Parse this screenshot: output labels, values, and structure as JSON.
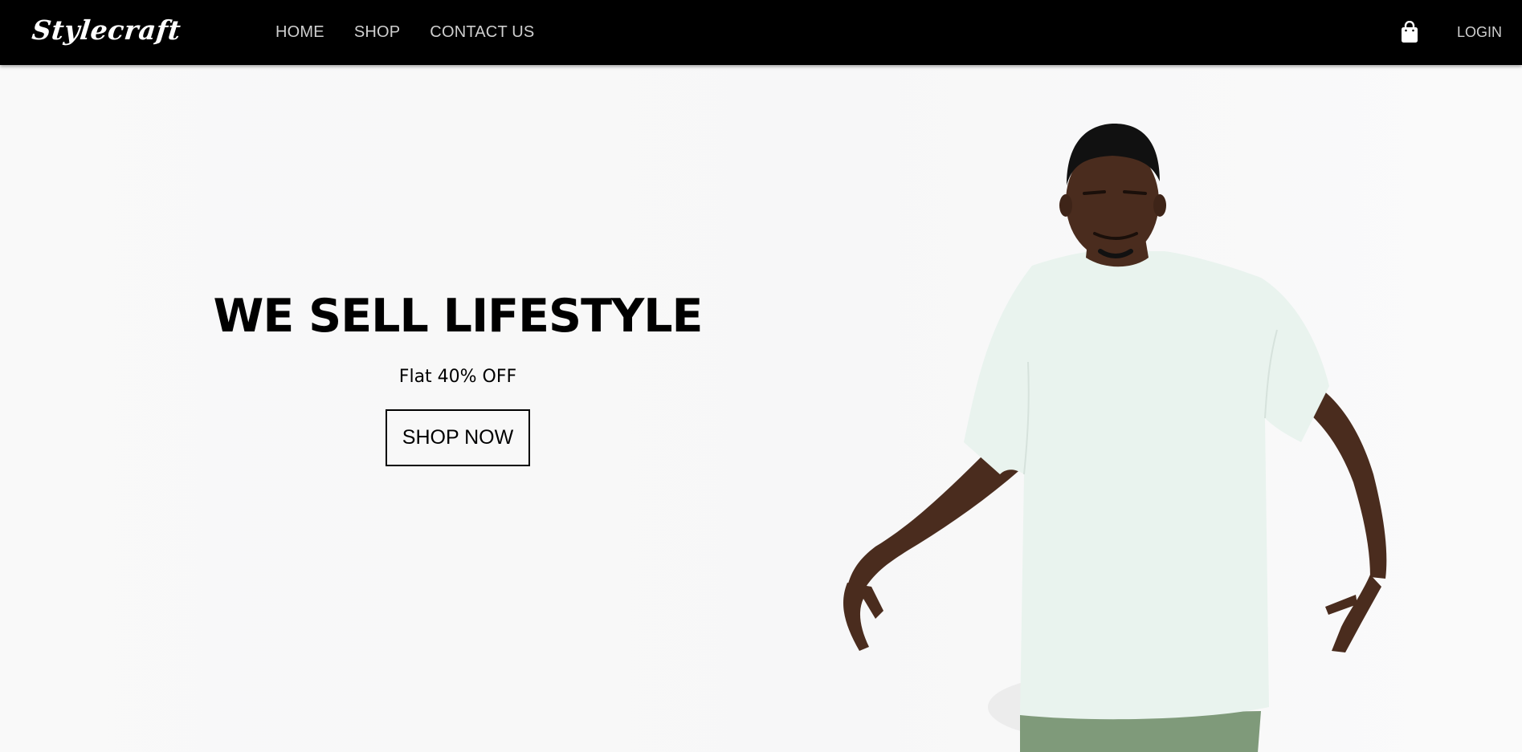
{
  "brand": {
    "name": "Stylecraft"
  },
  "nav": {
    "links": [
      {
        "label": "HOME"
      },
      {
        "label": "SHOP"
      },
      {
        "label": "CONTACT US"
      }
    ],
    "cart_icon": "shopping-bag-icon",
    "login_label": "LOGIN"
  },
  "hero": {
    "title": "WE SELL LIFESTYLE",
    "subtitle": "Flat 40% OFF",
    "cta_label": "SHOP NOW",
    "image_subject": "model-in-white-tshirt"
  },
  "colors": {
    "navbar_bg": "#000000",
    "nav_text": "#cfcfcf",
    "page_bg": "#f8f8f8",
    "text": "#000000"
  }
}
